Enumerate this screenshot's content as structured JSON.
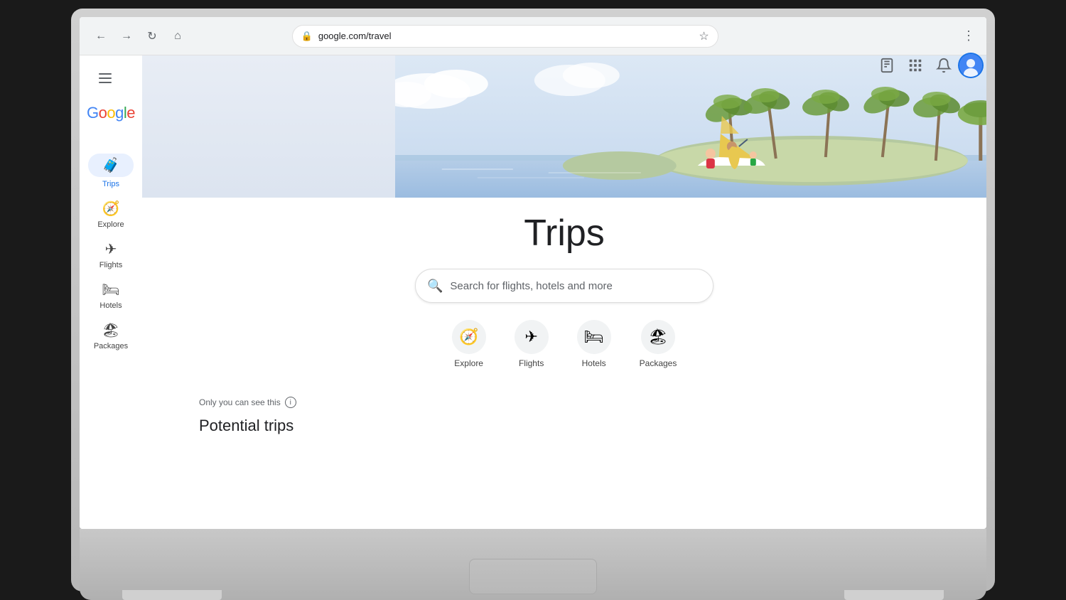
{
  "browser": {
    "back_label": "←",
    "forward_label": "→",
    "reload_label": "↻",
    "home_label": "⌂",
    "url": "google.com/travel",
    "bookmark_label": "☆",
    "menu_label": "⋮"
  },
  "header": {
    "hamburger_label": "☰",
    "google_logo": "Google",
    "bookmark_icon": "bookmarks",
    "apps_icon": "apps",
    "notifications_icon": "notifications"
  },
  "sidebar": {
    "items": [
      {
        "id": "trips",
        "label": "Trips",
        "icon": "🧳",
        "active": true
      },
      {
        "id": "explore",
        "label": "Explore",
        "icon": "🧭",
        "active": false
      },
      {
        "id": "flights",
        "label": "Flights",
        "icon": "✈",
        "active": false
      },
      {
        "id": "hotels",
        "label": "Hotels",
        "icon": "🛏",
        "active": false
      },
      {
        "id": "packages",
        "label": "Packages",
        "icon": "🏖",
        "active": false
      }
    ]
  },
  "hero": {
    "title": "Trips"
  },
  "search": {
    "placeholder": "Search for flights, hotels and more"
  },
  "quick_nav": [
    {
      "id": "explore",
      "label": "Explore",
      "icon": "🧭"
    },
    {
      "id": "flights",
      "label": "Flights",
      "icon": "✈"
    },
    {
      "id": "hotels",
      "label": "Hotels",
      "icon": "🛏"
    },
    {
      "id": "packages",
      "label": "Packages",
      "icon": "🏖"
    }
  ],
  "info": {
    "visibility_text": "Only you can see this",
    "info_icon": "i"
  },
  "potential_trips": {
    "title": "Potential trips"
  }
}
